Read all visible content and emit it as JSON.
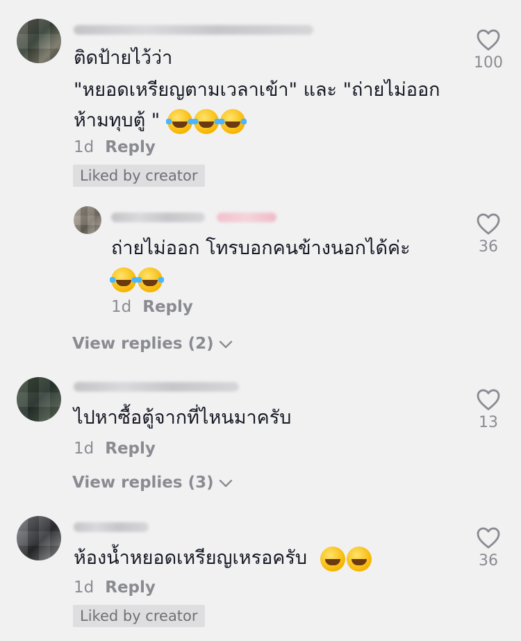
{
  "comments": [
    {
      "lines": [
        "ติดป้ายไว้ว่า",
        "\"หยอดเหรียญตามเวลาเข้า\" และ \"ถ่ายไม่ออก",
        "ห้ามทุบตู้ \""
      ],
      "emoji": "face-with-tears-of-joy",
      "emoji_count": 3,
      "time": "1d",
      "reply_label": "Reply",
      "badge": "Liked by creator",
      "likes": "100"
    },
    {
      "lines": [
        "ถ่ายไม่ออก โทรบอกคนข้างนอกได้ค่ะ"
      ],
      "emoji": "face-with-tears-of-joy",
      "emoji_count": 2,
      "time": "1d",
      "reply_label": "Reply",
      "likes": "36",
      "is_reply": true
    },
    {
      "lines": [
        "ไปหาซื้อตู้จากที่ไหนมาครับ"
      ],
      "time": "1d",
      "reply_label": "Reply",
      "likes": "13"
    },
    {
      "lines": [
        "ห้องน้ำหยอดเหรียญเหรอครับ"
      ],
      "emoji": "grinning-face",
      "emoji_count": 2,
      "time": "1d",
      "reply_label": "Reply",
      "badge": "Liked by creator",
      "likes": "36"
    }
  ],
  "view_replies": [
    "View replies (2)",
    "View replies (3)"
  ],
  "icons": {
    "like": "heart-outline-icon",
    "expand": "chevron-down-icon"
  },
  "colors": {
    "background": "#f1f1f2",
    "text": "#161823",
    "muted": "#8a8b91",
    "badge_bg": "#dedee0"
  }
}
